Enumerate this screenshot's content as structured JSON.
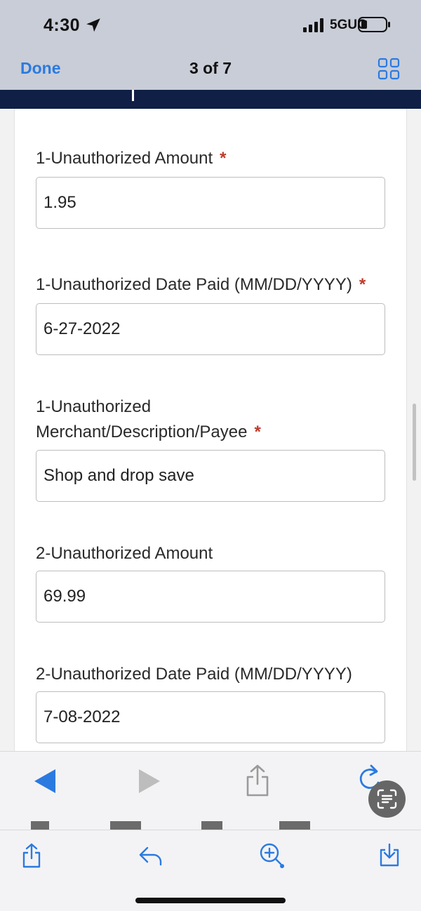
{
  "status_bar": {
    "time": "4:30",
    "network": "5GUC"
  },
  "nav": {
    "done_label": "Done",
    "page_indicator": "3 of 7"
  },
  "form": {
    "fields": [
      {
        "label": "1-Unauthorized Amount",
        "required": true,
        "value": "1.95"
      },
      {
        "label": "1-Unauthorized Date Paid (MM/DD/YYYY)",
        "required": true,
        "value": "6-27-2022"
      },
      {
        "label_line1": "1-Unauthorized",
        "label_line2": "Merchant/Description/Payee",
        "required": true,
        "value": "Shop and drop save"
      },
      {
        "label": "2-Unauthorized Amount",
        "required": false,
        "value": "69.99"
      },
      {
        "label": "2-Unauthorized Date Paid (MM/DD/YYYY)",
        "required": false,
        "value": "7-08-2022"
      }
    ],
    "required_marker": "*"
  },
  "icons": {
    "nav": [
      "grid-icon"
    ],
    "toolbar1": [
      "back-arrow-icon",
      "forward-arrow-icon",
      "share-icon",
      "redo-icon",
      "text-scan-icon"
    ],
    "toolbar2": [
      "share-icon",
      "reply-icon",
      "zoom-add-icon",
      "download-icon"
    ]
  },
  "colors": {
    "accent": "#2b7ae0",
    "header_band": "#0f1f45",
    "required": "#c0392b",
    "status_bg": "#c9cdd7"
  }
}
